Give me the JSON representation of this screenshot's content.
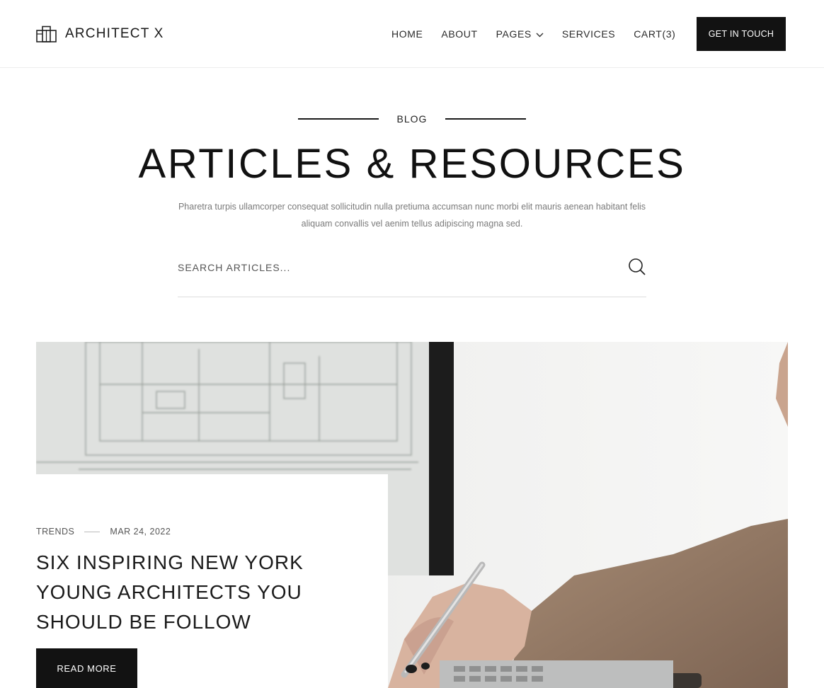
{
  "header": {
    "brand": "ARCHITECT X",
    "nav": [
      {
        "label": "HOME"
      },
      {
        "label": "ABOUT"
      },
      {
        "label": "PAGES"
      },
      {
        "label": "SERVICES"
      },
      {
        "label": "CART(3)"
      }
    ],
    "cta_label": "GET IN TOUCH"
  },
  "hero": {
    "eyebrow": "BLOG",
    "title": "ARTICLES & RESOURCES",
    "description": "Pharetra turpis ullamcorper consequat sollicitudin nulla pretiuma accumsan nunc morbi elit mauris aenean habitant felis aliquam convallis vel aenim tellus adipiscing magna sed."
  },
  "search": {
    "placeholder": "SEARCH ARTICLES...",
    "value": ""
  },
  "featured": {
    "category": "TRENDS",
    "date": "MAR 24, 2022",
    "title": "SIX INSPIRING NEW YORK YOUNG ARCHITECTS YOU SHOULD BE FOLLOW",
    "button_label": "READ MORE"
  },
  "icons": {
    "logo": "building-icon",
    "dropdown": "chevron-down-icon",
    "search": "search-icon"
  }
}
